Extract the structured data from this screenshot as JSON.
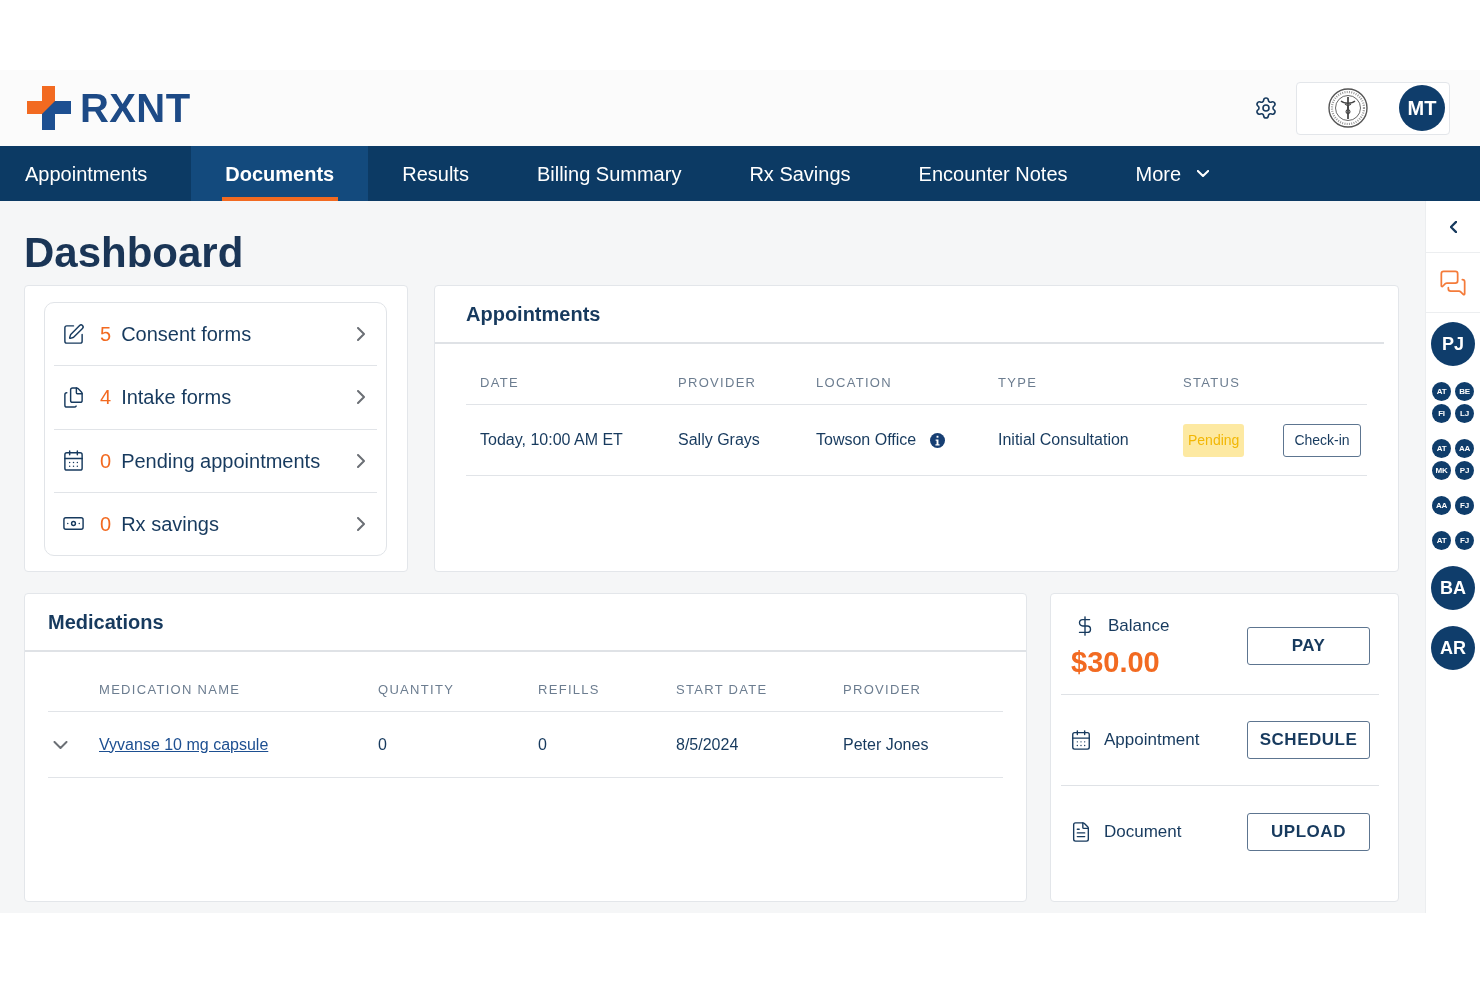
{
  "header": {
    "logo_text": "RXNT",
    "user_initials": "MT"
  },
  "nav": {
    "items": [
      {
        "label": "Appointments",
        "selected": false,
        "kind": "link"
      },
      {
        "label": "Documents",
        "selected": true,
        "kind": "link"
      },
      {
        "label": "Results",
        "selected": false,
        "kind": "link"
      },
      {
        "label": "Billing Summary",
        "selected": false,
        "kind": "link"
      },
      {
        "label": "Rx Savings",
        "selected": false,
        "kind": "link"
      },
      {
        "label": "Encounter Notes",
        "selected": false,
        "kind": "link"
      },
      {
        "label": "More",
        "selected": false,
        "kind": "dropdown"
      }
    ]
  },
  "page": {
    "title": "Dashboard"
  },
  "summary": {
    "items": [
      {
        "kind": "consent",
        "count": "5",
        "label": "Consent forms"
      },
      {
        "kind": "intake",
        "count": "4",
        "label": "Intake forms"
      },
      {
        "kind": "appointments",
        "count": "0",
        "label": "Pending appointments"
      },
      {
        "kind": "savings",
        "count": "0",
        "label": "Rx savings"
      }
    ]
  },
  "appointments": {
    "title": "Appointments",
    "columns": [
      "DATE",
      "PROVIDER",
      "LOCATION",
      "TYPE",
      "STATUS"
    ],
    "rows": [
      {
        "date": "Today, 10:00 AM ET",
        "provider": "Sally Grays",
        "location": "Towson Office",
        "type": "Initial Consultation",
        "status": "Pending",
        "action": "Check-in"
      }
    ]
  },
  "medications": {
    "title": "Medications",
    "columns": [
      "MEDICATION NAME",
      "QUANTITY",
      "REFILLS",
      "START DATE",
      "PROVIDER"
    ],
    "rows": [
      {
        "expanded": false,
        "name": "Vyvanse 10 mg capsule",
        "quantity": "0",
        "refills": "0",
        "start_date": "8/5/2024",
        "provider": "Peter Jones"
      }
    ]
  },
  "account": {
    "items": [
      {
        "kind": "balance",
        "label": "Balance",
        "amount": "$30.00",
        "button": "PAY"
      },
      {
        "kind": "appointment",
        "label": "Appointment",
        "button": "SCHEDULE"
      },
      {
        "kind": "document",
        "label": "Document",
        "button": "UPLOAD"
      }
    ]
  },
  "sidebar": {
    "avatars": [
      {
        "kind": "single",
        "initials": "PJ"
      },
      {
        "kind": "group",
        "members": [
          "AT",
          "BE",
          "FI",
          "LJ"
        ]
      },
      {
        "kind": "group",
        "members": [
          "AT",
          "AA",
          "MK",
          "PJ"
        ]
      },
      {
        "kind": "group",
        "members": [
          "AA",
          "FJ"
        ]
      },
      {
        "kind": "group",
        "members": [
          "AT",
          "FJ"
        ]
      },
      {
        "kind": "single",
        "initials": "BA"
      },
      {
        "kind": "single",
        "initials": "AR"
      }
    ]
  }
}
